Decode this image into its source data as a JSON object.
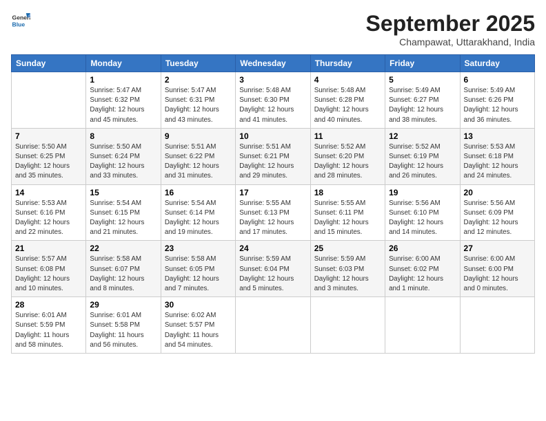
{
  "logo": {
    "text_general": "General",
    "text_blue": "Blue"
  },
  "title": {
    "main": "September 2025",
    "sub": "Champawat, Uttarakhand, India"
  },
  "days_of_week": [
    "Sunday",
    "Monday",
    "Tuesday",
    "Wednesday",
    "Thursday",
    "Friday",
    "Saturday"
  ],
  "weeks": [
    [
      {
        "day": "",
        "info": ""
      },
      {
        "day": "1",
        "info": "Sunrise: 5:47 AM\nSunset: 6:32 PM\nDaylight: 12 hours\nand 45 minutes."
      },
      {
        "day": "2",
        "info": "Sunrise: 5:47 AM\nSunset: 6:31 PM\nDaylight: 12 hours\nand 43 minutes."
      },
      {
        "day": "3",
        "info": "Sunrise: 5:48 AM\nSunset: 6:30 PM\nDaylight: 12 hours\nand 41 minutes."
      },
      {
        "day": "4",
        "info": "Sunrise: 5:48 AM\nSunset: 6:28 PM\nDaylight: 12 hours\nand 40 minutes."
      },
      {
        "day": "5",
        "info": "Sunrise: 5:49 AM\nSunset: 6:27 PM\nDaylight: 12 hours\nand 38 minutes."
      },
      {
        "day": "6",
        "info": "Sunrise: 5:49 AM\nSunset: 6:26 PM\nDaylight: 12 hours\nand 36 minutes."
      }
    ],
    [
      {
        "day": "7",
        "info": "Sunrise: 5:50 AM\nSunset: 6:25 PM\nDaylight: 12 hours\nand 35 minutes."
      },
      {
        "day": "8",
        "info": "Sunrise: 5:50 AM\nSunset: 6:24 PM\nDaylight: 12 hours\nand 33 minutes."
      },
      {
        "day": "9",
        "info": "Sunrise: 5:51 AM\nSunset: 6:22 PM\nDaylight: 12 hours\nand 31 minutes."
      },
      {
        "day": "10",
        "info": "Sunrise: 5:51 AM\nSunset: 6:21 PM\nDaylight: 12 hours\nand 29 minutes."
      },
      {
        "day": "11",
        "info": "Sunrise: 5:52 AM\nSunset: 6:20 PM\nDaylight: 12 hours\nand 28 minutes."
      },
      {
        "day": "12",
        "info": "Sunrise: 5:52 AM\nSunset: 6:19 PM\nDaylight: 12 hours\nand 26 minutes."
      },
      {
        "day": "13",
        "info": "Sunrise: 5:53 AM\nSunset: 6:18 PM\nDaylight: 12 hours\nand 24 minutes."
      }
    ],
    [
      {
        "day": "14",
        "info": "Sunrise: 5:53 AM\nSunset: 6:16 PM\nDaylight: 12 hours\nand 22 minutes."
      },
      {
        "day": "15",
        "info": "Sunrise: 5:54 AM\nSunset: 6:15 PM\nDaylight: 12 hours\nand 21 minutes."
      },
      {
        "day": "16",
        "info": "Sunrise: 5:54 AM\nSunset: 6:14 PM\nDaylight: 12 hours\nand 19 minutes."
      },
      {
        "day": "17",
        "info": "Sunrise: 5:55 AM\nSunset: 6:13 PM\nDaylight: 12 hours\nand 17 minutes."
      },
      {
        "day": "18",
        "info": "Sunrise: 5:55 AM\nSunset: 6:11 PM\nDaylight: 12 hours\nand 15 minutes."
      },
      {
        "day": "19",
        "info": "Sunrise: 5:56 AM\nSunset: 6:10 PM\nDaylight: 12 hours\nand 14 minutes."
      },
      {
        "day": "20",
        "info": "Sunrise: 5:56 AM\nSunset: 6:09 PM\nDaylight: 12 hours\nand 12 minutes."
      }
    ],
    [
      {
        "day": "21",
        "info": "Sunrise: 5:57 AM\nSunset: 6:08 PM\nDaylight: 12 hours\nand 10 minutes."
      },
      {
        "day": "22",
        "info": "Sunrise: 5:58 AM\nSunset: 6:07 PM\nDaylight: 12 hours\nand 8 minutes."
      },
      {
        "day": "23",
        "info": "Sunrise: 5:58 AM\nSunset: 6:05 PM\nDaylight: 12 hours\nand 7 minutes."
      },
      {
        "day": "24",
        "info": "Sunrise: 5:59 AM\nSunset: 6:04 PM\nDaylight: 12 hours\nand 5 minutes."
      },
      {
        "day": "25",
        "info": "Sunrise: 5:59 AM\nSunset: 6:03 PM\nDaylight: 12 hours\nand 3 minutes."
      },
      {
        "day": "26",
        "info": "Sunrise: 6:00 AM\nSunset: 6:02 PM\nDaylight: 12 hours\nand 1 minute."
      },
      {
        "day": "27",
        "info": "Sunrise: 6:00 AM\nSunset: 6:00 PM\nDaylight: 12 hours\nand 0 minutes."
      }
    ],
    [
      {
        "day": "28",
        "info": "Sunrise: 6:01 AM\nSunset: 5:59 PM\nDaylight: 11 hours\nand 58 minutes."
      },
      {
        "day": "29",
        "info": "Sunrise: 6:01 AM\nSunset: 5:58 PM\nDaylight: 11 hours\nand 56 minutes."
      },
      {
        "day": "30",
        "info": "Sunrise: 6:02 AM\nSunset: 5:57 PM\nDaylight: 11 hours\nand 54 minutes."
      },
      {
        "day": "",
        "info": ""
      },
      {
        "day": "",
        "info": ""
      },
      {
        "day": "",
        "info": ""
      },
      {
        "day": "",
        "info": ""
      }
    ]
  ]
}
